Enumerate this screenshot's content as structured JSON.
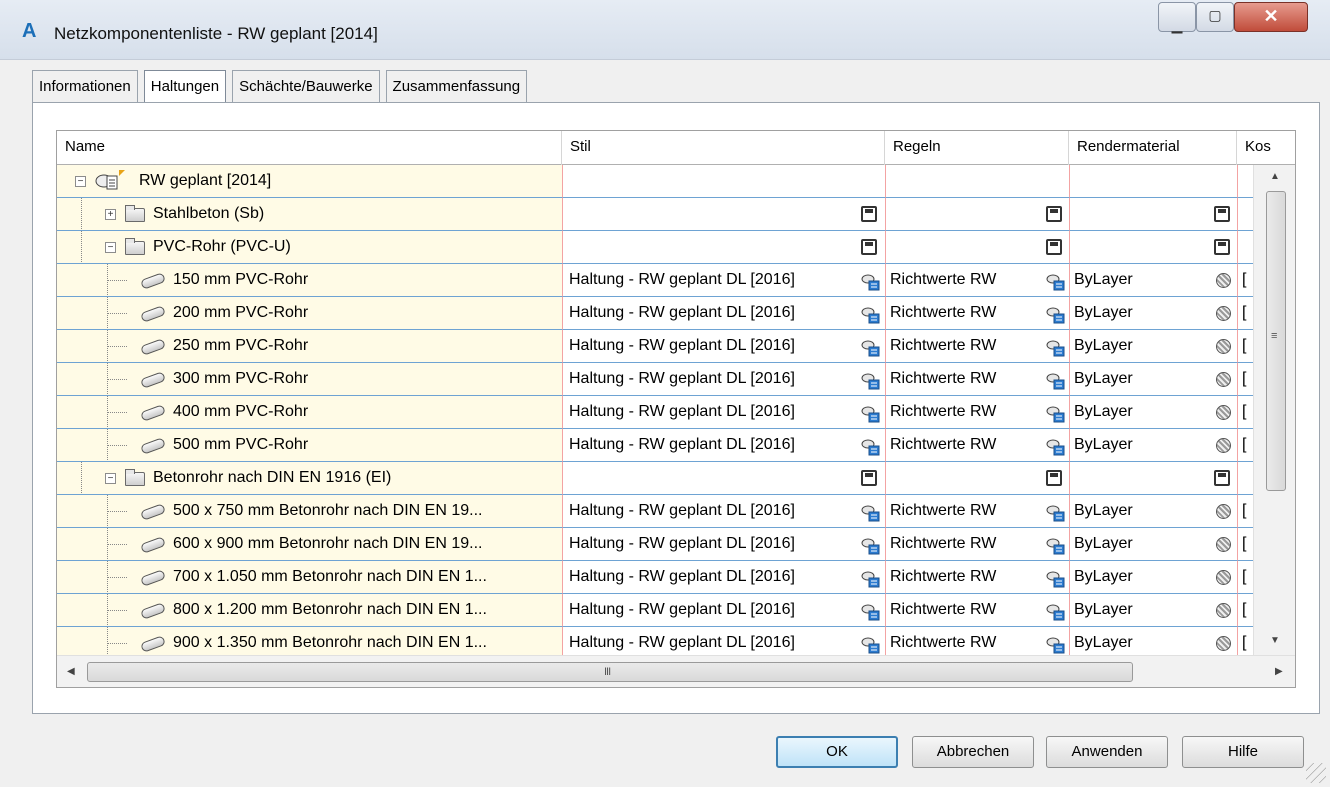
{
  "window": {
    "title": "Netzkomponentenliste - RW geplant [2014]",
    "app_icon": "A",
    "minimize_icon": "minimize-icon",
    "maximize_icon": "maximize-icon",
    "close_icon": "close-icon"
  },
  "tabs": [
    {
      "label": "Informationen",
      "active": false
    },
    {
      "label": "Haltungen",
      "active": true
    },
    {
      "label": "Schächte/Bauwerke",
      "active": false
    },
    {
      "label": "Zusammenfassung",
      "active": false
    }
  ],
  "grid": {
    "columns": [
      {
        "label": "Name"
      },
      {
        "label": "Stil"
      },
      {
        "label": "Regeln"
      },
      {
        "label": "Rendermaterial"
      },
      {
        "label": "Kos"
      }
    ],
    "rows": [
      {
        "level": 0,
        "type": "network",
        "expander": "⊟",
        "name": "RW geplant [2014]",
        "stil": "",
        "regeln": "",
        "render": ""
      },
      {
        "level": 1,
        "type": "folder",
        "expander": "⊞",
        "name": "Stahlbeton (Sb)",
        "stil": "",
        "regeln": "",
        "render": ""
      },
      {
        "level": 1,
        "type": "folder",
        "expander": "⊟",
        "name": "PVC-Rohr (PVC-U)",
        "stil": "",
        "regeln": "",
        "render": ""
      },
      {
        "level": 2,
        "type": "pipe",
        "name": "150 mm PVC-Rohr",
        "stil": "Haltung - RW geplant DL [2016]",
        "regeln": "Richtwerte RW",
        "render": "ByLayer",
        "kos": "["
      },
      {
        "level": 2,
        "type": "pipe",
        "name": "200 mm PVC-Rohr",
        "stil": "Haltung - RW geplant DL [2016]",
        "regeln": "Richtwerte RW",
        "render": "ByLayer",
        "kos": "["
      },
      {
        "level": 2,
        "type": "pipe",
        "name": "250 mm PVC-Rohr",
        "stil": "Haltung - RW geplant DL [2016]",
        "regeln": "Richtwerte RW",
        "render": "ByLayer",
        "kos": "["
      },
      {
        "level": 2,
        "type": "pipe",
        "name": "300 mm PVC-Rohr",
        "stil": "Haltung - RW geplant DL [2016]",
        "regeln": "Richtwerte RW",
        "render": "ByLayer",
        "kos": "["
      },
      {
        "level": 2,
        "type": "pipe",
        "name": "400 mm PVC-Rohr",
        "stil": "Haltung - RW geplant DL [2016]",
        "regeln": "Richtwerte RW",
        "render": "ByLayer",
        "kos": "["
      },
      {
        "level": 2,
        "type": "pipe",
        "name": "500 mm PVC-Rohr",
        "stil": "Haltung - RW geplant DL [2016]",
        "regeln": "Richtwerte RW",
        "render": "ByLayer",
        "kos": "["
      },
      {
        "level": 1,
        "type": "folder",
        "expander": "⊟",
        "name": "Betonrohr nach DIN EN 1916 (EI)",
        "stil": "",
        "regeln": "",
        "render": ""
      },
      {
        "level": 2,
        "type": "pipe",
        "name": "500 x 750 mm Betonrohr nach DIN EN 19...",
        "stil": "Haltung - RW geplant DL [2016]",
        "regeln": "Richtwerte RW",
        "render": "ByLayer",
        "kos": "["
      },
      {
        "level": 2,
        "type": "pipe",
        "name": "600 x 900 mm Betonrohr nach DIN EN 19...",
        "stil": "Haltung - RW geplant DL [2016]",
        "regeln": "Richtwerte RW",
        "render": "ByLayer",
        "kos": "["
      },
      {
        "level": 2,
        "type": "pipe",
        "name": "700 x 1.050 mm Betonrohr nach DIN EN 1...",
        "stil": "Haltung - RW geplant DL [2016]",
        "regeln": "Richtwerte RW",
        "render": "ByLayer",
        "kos": "["
      },
      {
        "level": 2,
        "type": "pipe",
        "name": "800 x 1.200 mm Betonrohr nach DIN EN 1...",
        "stil": "Haltung - RW geplant DL [2016]",
        "regeln": "Richtwerte RW",
        "render": "ByLayer",
        "kos": "["
      },
      {
        "level": 2,
        "type": "pipe",
        "name": "900 x 1.350 mm Betonrohr nach DIN EN 1...",
        "stil": "Haltung - RW geplant DL [2016]",
        "regeln": "Richtwerte RW",
        "render": "ByLayer",
        "kos": "["
      }
    ]
  },
  "scroll": {
    "vertical_grip": "≡",
    "horizontal_grip": "III",
    "up_arrow": "▲",
    "down_arrow": "▼",
    "left_arrow": "◀",
    "right_arrow": "▶"
  },
  "buttons": {
    "ok": "OK",
    "cancel": "Abbrechen",
    "apply": "Anwenden",
    "help": "Hilfe"
  },
  "colors": {
    "name_column_bg": "#fffbe6",
    "row_separator": "#6ea3d3",
    "column_separator": "#f3a3a3"
  }
}
